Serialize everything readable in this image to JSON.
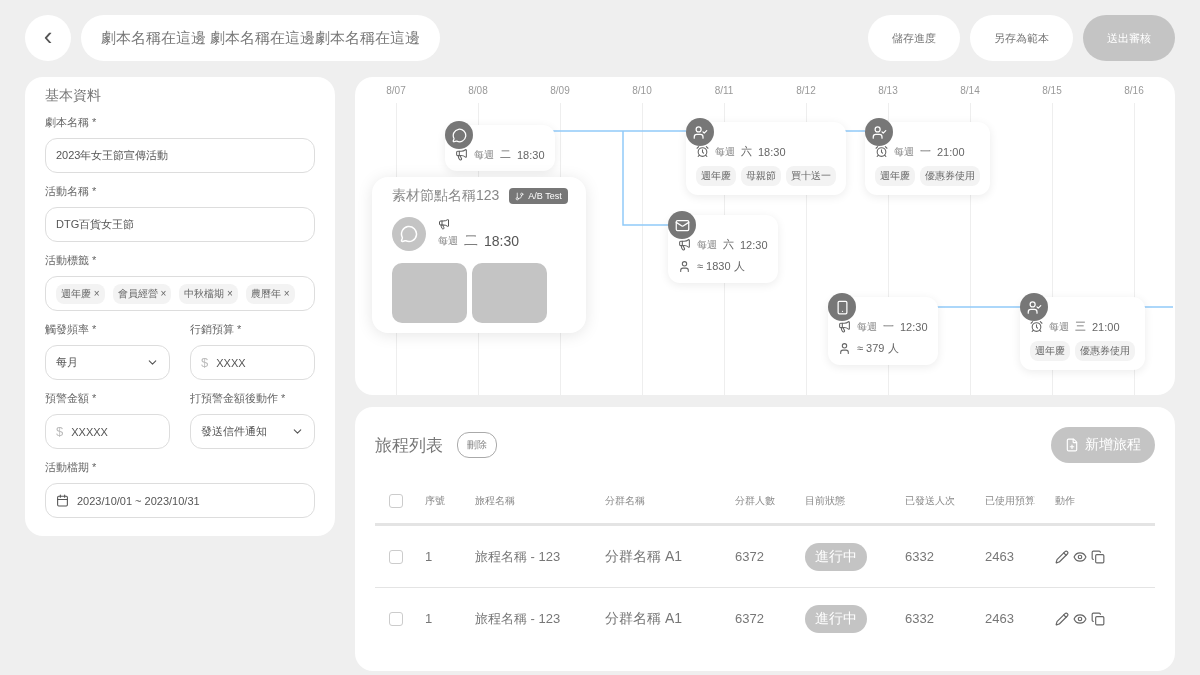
{
  "header": {
    "back": "‹",
    "title": "劇本名稱在這邊 劇本名稱在這邊劇本名稱在這邊",
    "buttons": [
      {
        "label": "儲存進度",
        "kind": "secondary"
      },
      {
        "label": "另存為範本",
        "kind": "secondary"
      },
      {
        "label": "送出審核",
        "kind": "primary"
      }
    ]
  },
  "form": {
    "title": "基本資料",
    "fields": [
      {
        "kind": "text",
        "label": "劇本名稱 *",
        "value": "2023年女王節宣傳活動"
      },
      {
        "kind": "text",
        "label": "活動名稱 *",
        "value": "DTG百貨女王節"
      },
      {
        "kind": "tags",
        "label": "活動標籤 *",
        "tags": [
          {
            "label": "週年慶",
            "remove": "×"
          },
          {
            "label": "會員經營",
            "remove": "×"
          },
          {
            "label": "中秋檔期",
            "remove": "×"
          },
          {
            "label": "農曆年",
            "remove": "×"
          }
        ]
      },
      {
        "kind": "select",
        "label": "觸發頻率 *",
        "value": "每月"
      },
      {
        "kind": "money",
        "label": "行銷預算 *",
        "currency": "$",
        "value": "XXXX"
      },
      {
        "kind": "money",
        "label": "預警金額 *",
        "currency": "$",
        "value": "XXXXX"
      },
      {
        "kind": "select",
        "label": "打預警金額後動作 *",
        "value": "發送信件通知"
      },
      {
        "kind": "date",
        "label": "活動檔期 *",
        "value": "2023/10/01 ~ 2023/10/31"
      }
    ]
  },
  "timeline": {
    "dates": [
      "8/07",
      "8/08",
      "8/09",
      "8/10",
      "8/11",
      "8/12",
      "8/13",
      "8/14",
      "8/15",
      "8/16"
    ],
    "nodes": [
      {
        "kind": "chat",
        "schedule": {
          "kind": "broadcast",
          "every": "每週",
          "day": "二",
          "time": "18:30"
        }
      },
      {
        "kind": "user-check",
        "schedule": {
          "kind": "alarm",
          "every": "每週",
          "day": "六",
          "time": "18:30"
        },
        "tags": [
          "週年慶",
          "母親節",
          "買十送一"
        ]
      },
      {
        "kind": "user-check",
        "schedule": {
          "kind": "alarm",
          "every": "每週",
          "day": "一",
          "time": "21:00"
        },
        "tags": [
          "週年慶",
          "優惠券使用"
        ]
      },
      {
        "kind": "mail",
        "schedule": {
          "kind": "broadcast",
          "every": "每週",
          "day": "六",
          "time": "12:30"
        },
        "audience": "≈ 1830 人"
      },
      {
        "kind": "phone",
        "schedule": {
          "kind": "broadcast",
          "every": "每週",
          "day": "一",
          "time": "12:30"
        },
        "audience": "≈ 379 人"
      },
      {
        "kind": "user-check",
        "schedule": {
          "kind": "alarm",
          "every": "每週",
          "day": "三",
          "time": "21:00"
        },
        "tags": [
          "週年慶",
          "優惠券使用"
        ]
      }
    ],
    "popup": {
      "title": "素材節點名稱123",
      "badge": "A/B Test",
      "every": "每週",
      "day": "二",
      "time": "18:30"
    }
  },
  "journeys": {
    "title": "旅程列表",
    "delete": "刪除",
    "add": "新增旅程",
    "columns": [
      "序號",
      "旅程名稱",
      "分群名稱",
      "分群人數",
      "目前狀態",
      "已發送人次",
      "已使用預算",
      "動作"
    ],
    "all_checked": false,
    "rows": [
      {
        "checked": false,
        "cells": [
          "1",
          "旅程名稱 - 123",
          "分群名稱 A1",
          "6372"
        ],
        "status": "進行中",
        "sent": "6332",
        "budget": "2463"
      },
      {
        "checked": false,
        "cells": [
          "1",
          "旅程名稱 - 123",
          "分群名稱 A1",
          "6372"
        ],
        "status": "進行中",
        "sent": "6332",
        "budget": "2463"
      }
    ]
  }
}
